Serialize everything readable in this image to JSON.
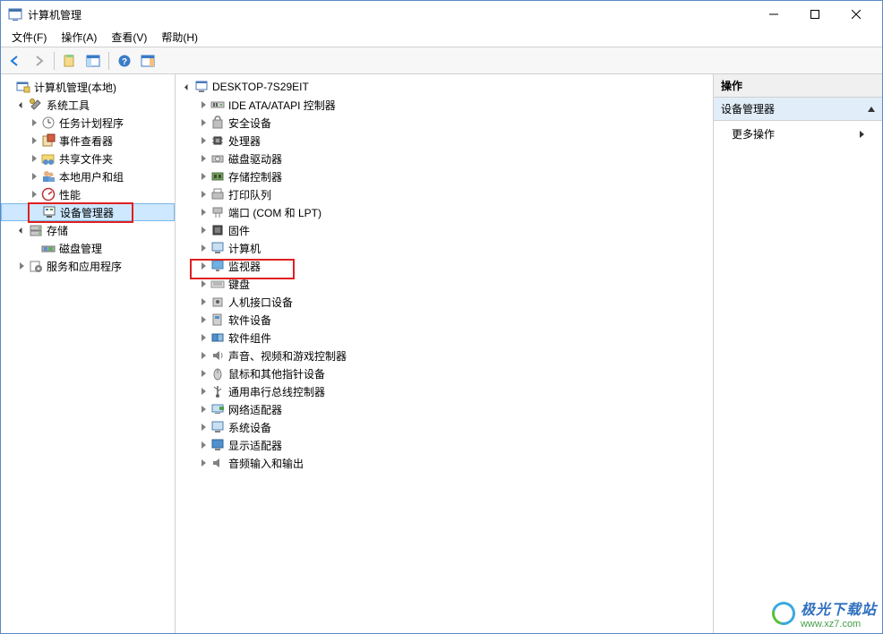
{
  "window": {
    "title": "计算机管理"
  },
  "menubar": {
    "file": "文件(F)",
    "action": "操作(A)",
    "view": "查看(V)",
    "help": "帮助(H)"
  },
  "toolbar_icons": {
    "back": "back-arrow",
    "forward": "forward-arrow",
    "up": "properties",
    "show_hide": "show-hide",
    "help": "help",
    "refresh": "refresh"
  },
  "left_tree": {
    "root": "计算机管理(本地)",
    "system_tools": {
      "label": "系统工具",
      "task_scheduler": "任务计划程序",
      "event_viewer": "事件查看器",
      "shared_folders": "共享文件夹",
      "local_users": "本地用户和组",
      "performance": "性能",
      "device_manager": "设备管理器"
    },
    "storage": {
      "label": "存储",
      "disk_mgmt": "磁盘管理"
    },
    "services": "服务和应用程序"
  },
  "center_tree": {
    "root": "DESKTOP-7S29EIT",
    "items": [
      "IDE ATA/ATAPI 控制器",
      "安全设备",
      "处理器",
      "磁盘驱动器",
      "存储控制器",
      "打印队列",
      "端口 (COM 和 LPT)",
      "固件",
      "计算机",
      "监视器",
      "键盘",
      "人机接口设备",
      "软件设备",
      "软件组件",
      "声音、视频和游戏控制器",
      "鼠标和其他指针设备",
      "通用串行总线控制器",
      "网络适配器",
      "系统设备",
      "显示适配器",
      "音频输入和输出"
    ]
  },
  "right_pane": {
    "header": "操作",
    "section": "设备管理器",
    "more_actions": "更多操作"
  },
  "watermark": {
    "name": "极光下载站",
    "url": "www.xz7.com"
  },
  "highlights": {
    "device_manager_box": true,
    "keyboard_box": true
  },
  "colors": {
    "selection_bg": "#cde8ff",
    "highlight_red": "#e02020",
    "right_section_bg": "#e1edf9"
  }
}
